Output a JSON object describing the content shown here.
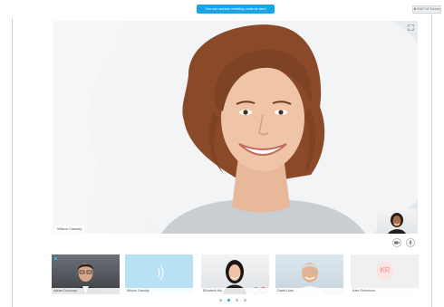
{
  "banner": {
    "text": "You can access meeting controls here"
  },
  "exit_fullscreen": {
    "label": "✖ Exit Full Screen"
  },
  "main_video": {
    "speaker_name": "Wilson Cassidy"
  },
  "participants": [
    {
      "name": "Adrian Donovan",
      "kind": "video",
      "speaking": true
    },
    {
      "name": "Wilson Cassidy",
      "kind": "audio",
      "speaking": false
    },
    {
      "name": "Elizabeth Wu",
      "kind": "video",
      "speaking": false,
      "muted": true
    },
    {
      "name": "David Liam",
      "kind": "video",
      "speaking": false
    },
    {
      "name": "Kate Robertson",
      "kind": "initials",
      "initials": "KR",
      "speaking": false
    }
  ],
  "pagination": {
    "pages": 4,
    "current": 2
  },
  "colors": {
    "accent": "#1aa3e8",
    "initials_bg": "#fde4e4",
    "initials_fg": "#f08f8f",
    "muted_red": "#e06060"
  },
  "icons": {
    "expand": "expand-icon",
    "camera": "video-camera-icon",
    "mic": "microphone-icon",
    "audio_wave": "audio-wave-icon"
  }
}
